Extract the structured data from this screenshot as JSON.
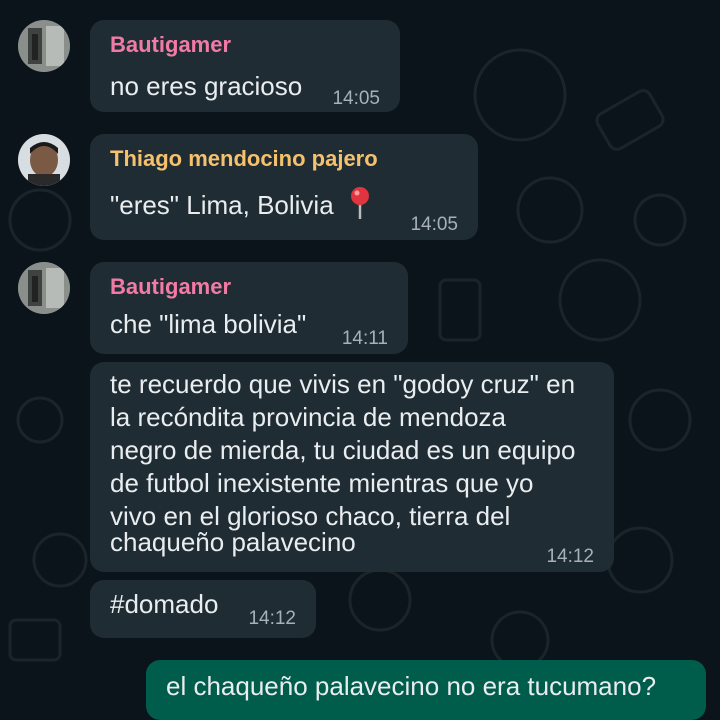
{
  "colors": {
    "background": "#0b141a",
    "incoming_bubble": "#1f2c34",
    "outgoing_bubble": "#005c4b",
    "sender_pink": "#f27ba6",
    "sender_yellow": "#f5c16c",
    "timestamp": "#a7b1b7"
  },
  "messages": [
    {
      "sender": "Bautigamer",
      "text": "no eres gracioso",
      "time": "14:05"
    },
    {
      "sender": "Thiago mendocino pajero",
      "text": "\"eres\" Lima, Bolivia",
      "icon": "round-pushpin-icon",
      "time": "14:05"
    },
    {
      "sender": "Bautigamer",
      "text": "che \"lima bolivia\"",
      "time": "14:11"
    },
    {
      "lines": [
        "te recuerdo que vivis en \"godoy cruz\" en",
        "la recóndita provincia de mendoza",
        "negro de mierda, tu ciudad es un equipo",
        "de futbol inexistente mientras que yo",
        "vivo en el glorioso chaco, tierra del",
        "chaqueño palavecino"
      ],
      "time": "14:12"
    },
    {
      "text": "#domado",
      "time": "14:12"
    },
    {
      "text": "el chaqueño palavecino no era tucumano?",
      "direction": "outgoing"
    }
  ]
}
